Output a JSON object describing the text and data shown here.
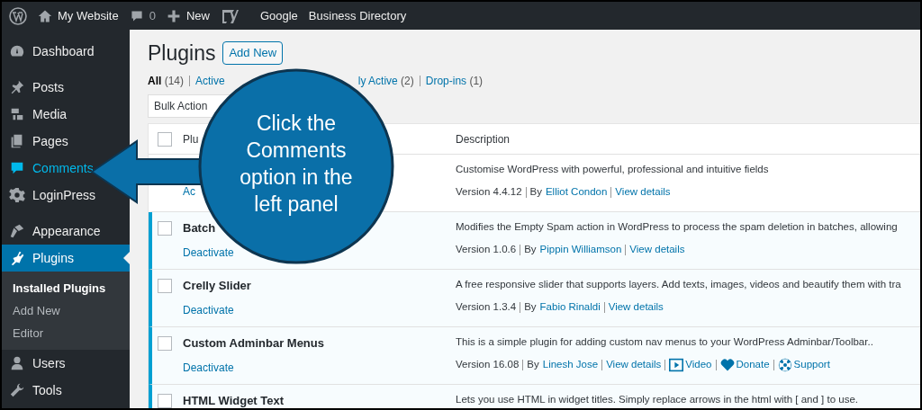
{
  "admin_bar": {
    "site": "My Website",
    "comments": "0",
    "new": "New",
    "links": [
      "Google",
      "Business Directory"
    ]
  },
  "sidebar": {
    "items": [
      {
        "label": "Dashboard",
        "selected": false,
        "highlighted": false
      },
      {
        "label": "Posts",
        "selected": false,
        "highlighted": false
      },
      {
        "label": "Media",
        "selected": false,
        "highlighted": false
      },
      {
        "label": "Pages",
        "selected": false,
        "highlighted": false
      },
      {
        "label": "Comments",
        "selected": false,
        "highlighted": true
      },
      {
        "label": "LoginPress",
        "selected": false,
        "highlighted": false
      },
      {
        "label": "Appearance",
        "selected": false,
        "highlighted": false
      },
      {
        "label": "Plugins",
        "selected": true,
        "highlighted": false,
        "children": [
          {
            "label": "Installed Plugins",
            "selected": true
          },
          {
            "label": "Add New",
            "selected": false
          },
          {
            "label": "Editor",
            "selected": false
          }
        ]
      },
      {
        "label": "Users",
        "selected": false,
        "highlighted": false
      },
      {
        "label": "Tools",
        "selected": false,
        "highlighted": false
      }
    ]
  },
  "page": {
    "title": "Plugins",
    "add_button": "Add New",
    "filters": [
      {
        "label": "All",
        "count": "(14)",
        "selected": true
      },
      {
        "label": "Active",
        "selected": false
      },
      {
        "label": "ly Active",
        "count": "(2)",
        "selected": false
      },
      {
        "label": "Drop-ins",
        "count": "(1)",
        "selected": false
      }
    ],
    "bulk_select": "Bulk Action",
    "table": {
      "select_all": {
        "checked": false
      },
      "columns": [
        "Plu",
        "Description"
      ],
      "rows": [
        {
          "action": "Ac",
          "active": false,
          "description": "Customise WordPress with powerful, professional and intuitive fields",
          "version": "Version 4.4.12",
          "by": "By",
          "author": "Elliot Condon",
          "links": [
            {
              "kind": "text",
              "label": "View details"
            }
          ]
        },
        {
          "name": "Batch",
          "action": "Deactivate",
          "active": true,
          "checked": false,
          "description": "Modifies the Empty Spam action in WordPress to process the spam deletion in batches, allowing",
          "version": "Version 1.0.6",
          "by": "By",
          "author": "Pippin Williamson",
          "links": [
            {
              "kind": "text",
              "label": "View details"
            }
          ]
        },
        {
          "name": "Crelly Slider",
          "action": "Deactivate",
          "active": true,
          "checked": false,
          "description": "A free responsive slider that supports layers. Add texts, images, videos and beautify them with tra",
          "version": "Version 1.3.4",
          "by": "By",
          "author": "Fabio Rinaldi",
          "links": [
            {
              "kind": "text",
              "label": "View details"
            }
          ]
        },
        {
          "name": "Custom Adminbar Menus",
          "action": "Deactivate",
          "active": true,
          "checked": false,
          "description": "This is a simple plugin for adding custom nav menus to your WordPress Adminbar/Toolbar..",
          "version": "Version 16.08",
          "by": "By",
          "author": "Linesh Jose",
          "links": [
            {
              "kind": "text",
              "label": "View details"
            },
            {
              "kind": "video",
              "label": "Video"
            },
            {
              "kind": "heart",
              "label": "Donate"
            },
            {
              "kind": "lifebuoy",
              "label": "Support"
            }
          ]
        },
        {
          "name": "HTML Widget Text",
          "active": true,
          "checked": false,
          "description": "Lets you use HTML in widget titles. Simply replace arrows in the html with [ and ] to use."
        }
      ]
    }
  },
  "callout": {
    "lines": [
      "Click the",
      "Comments",
      "option in the",
      "left panel"
    ]
  }
}
